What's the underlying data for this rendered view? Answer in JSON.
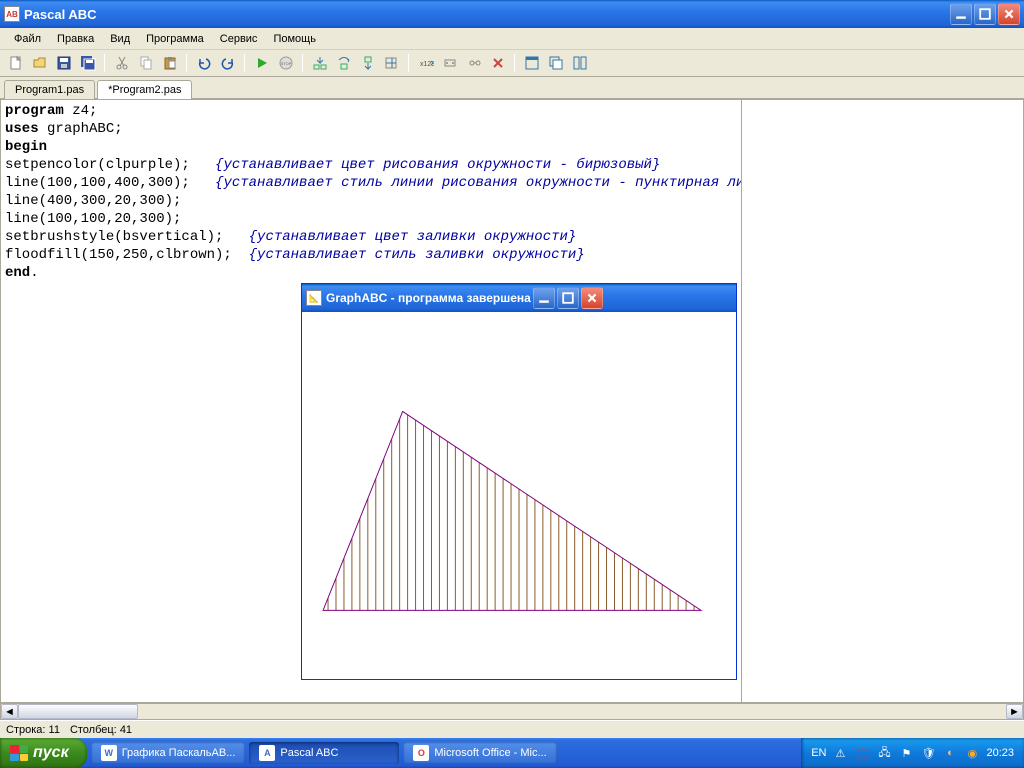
{
  "window": {
    "title": "Pascal ABC"
  },
  "menu": {
    "items": [
      "Файл",
      "Правка",
      "Вид",
      "Программа",
      "Сервис",
      "Помощь"
    ]
  },
  "tabs": {
    "items": [
      "Program1.pas",
      "*Program2.pas"
    ],
    "active": 1
  },
  "code": {
    "line1_kw": "program",
    "line1_rest": " z4;",
    "line2_kw": "uses",
    "line2_rest": " graphABC;",
    "line3_kw": "begin",
    "line4": "setpencolor(clpurple);   ",
    "line4_cm": "{устанавливает цвет рисования окружности - бирюзовый}",
    "line5": "line(100,100,400,300);   ",
    "line5_cm": "{устанавливает стиль линии рисования окружности - пунктирная линия}",
    "line6": "line(400,300,20,300);",
    "line7": "line(100,100,20,300);",
    "line8": "setbrushstyle(bsvertical);   ",
    "line8_cm": "{устанавливает цвет заливки окружности}",
    "line9": "floodfill(150,250,clbrown);  ",
    "line9_cm": "{устанавливает стиль заливки окружности}",
    "line10_kw": "end",
    "line10_rest": "."
  },
  "status": {
    "line_label": "Строка: ",
    "line_val": "11",
    "col_label": "Столбец: ",
    "col_val": "41"
  },
  "graph_window": {
    "title": "GraphABC - программа завершена"
  },
  "taskbar": {
    "start": "пуск",
    "items": [
      {
        "label": "Графика ПаскальАВ...",
        "icon": "W"
      },
      {
        "label": "Pascal ABC",
        "icon": "A"
      },
      {
        "label": "Microsoft Office - Mic...",
        "icon": "O"
      }
    ],
    "lang": "EN",
    "time": "20:23"
  }
}
